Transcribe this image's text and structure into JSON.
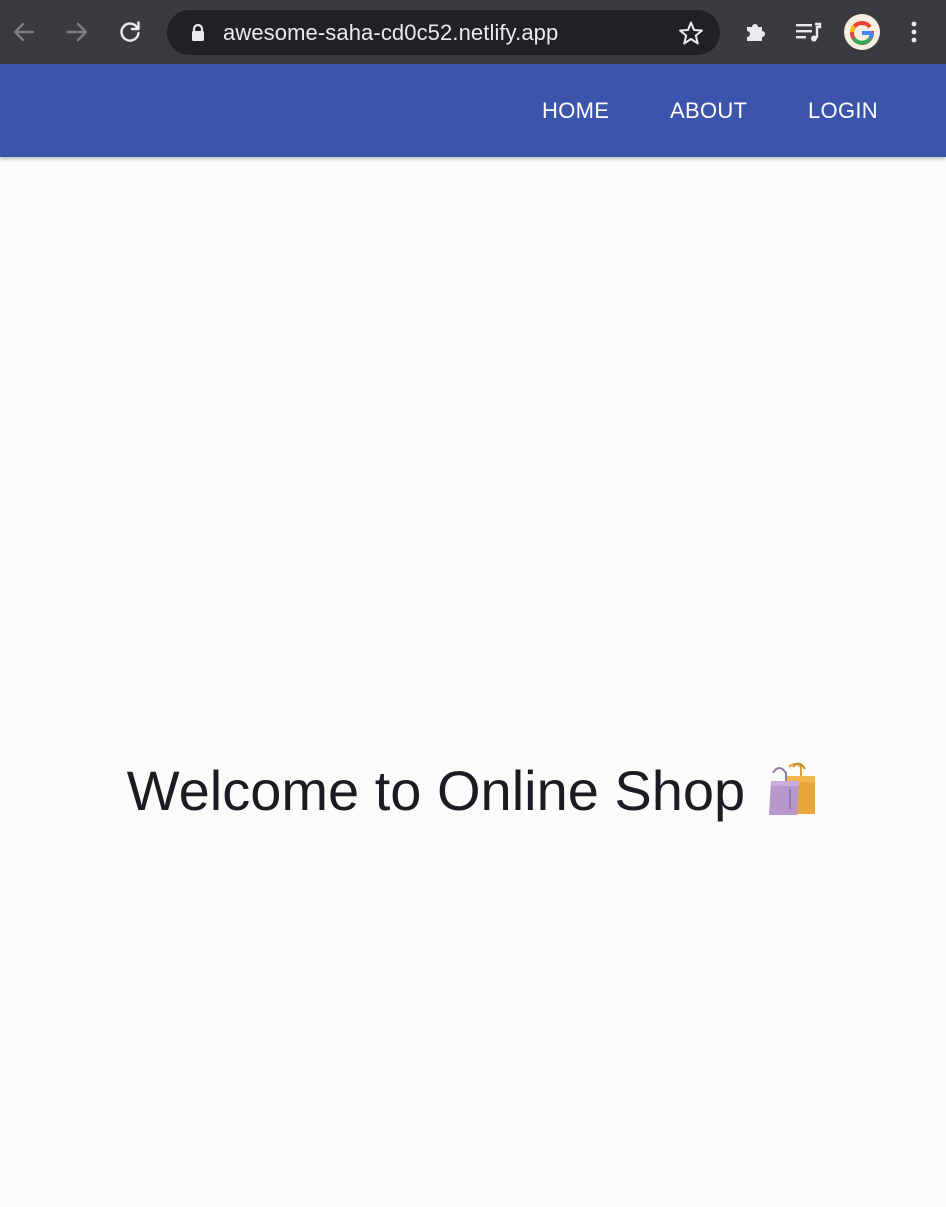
{
  "browser": {
    "url": "awesome-saha-cd0c52.netlify.app",
    "back_icon": "arrow-left-icon",
    "forward_icon": "arrow-right-icon",
    "reload_icon": "reload-icon",
    "lock_icon": "lock-icon",
    "bookmark_icon": "star-icon",
    "extensions_icon": "puzzle-icon",
    "media_icon": "music-queue-icon",
    "profile_icon": "google-avatar-icon",
    "menu_icon": "kebab-menu-icon"
  },
  "navbar": {
    "color": "#3c54ab",
    "links": [
      {
        "label": "HOME"
      },
      {
        "label": "ABOUT"
      },
      {
        "label": "LOGIN"
      }
    ]
  },
  "main": {
    "heading": "Welcome to Online Shop",
    "heading_icon": "shopping-bags-icon"
  },
  "colors": {
    "background": "#fbfbf9",
    "chrome": "#3a3b3e",
    "omnibox": "#202124"
  }
}
